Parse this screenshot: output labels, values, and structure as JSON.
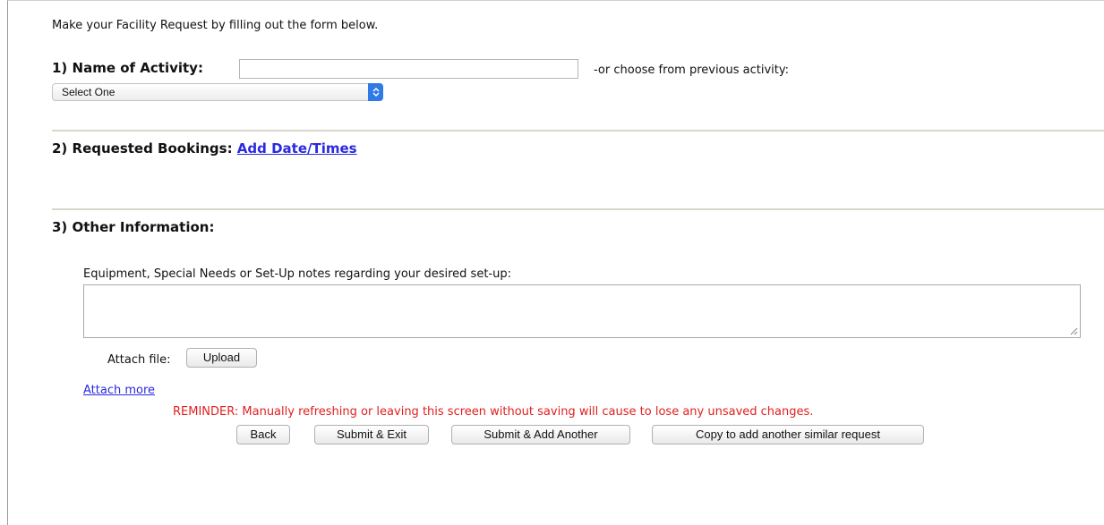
{
  "intro": "Make your Facility Request by filling out the form below.",
  "section1": {
    "label": "1) Name of Activity:",
    "name_value": "",
    "or_text": "-or choose from previous activity:",
    "select_value": "Select One"
  },
  "section2": {
    "label": "2) Requested Bookings:",
    "add_link": "Add Date/Times"
  },
  "section3": {
    "label": "3) Other Information:",
    "notes_label": "Equipment, Special Needs or Set-Up notes regarding your desired set-up:",
    "notes_value": "",
    "attach_label": "Attach file:",
    "upload_button": "Upload",
    "attach_more_link": "Attach more"
  },
  "reminder": "REMINDER: Manually refreshing or leaving this screen without saving will cause to lose any unsaved changes.",
  "buttons": {
    "back": "Back",
    "submit_exit": "Submit & Exit",
    "submit_add": "Submit & Add Another",
    "copy": "Copy to add another similar request"
  },
  "colors": {
    "link": "#2a2ae0",
    "reminder": "#e02020",
    "select_arrow": "#2f7ae6",
    "divider": "#d8d6cb"
  }
}
